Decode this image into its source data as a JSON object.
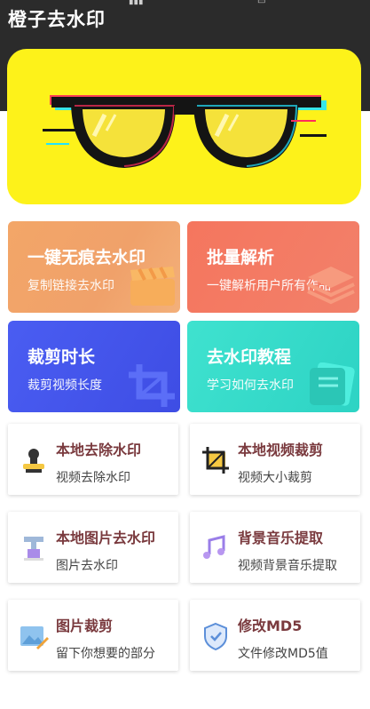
{
  "app": {
    "title": "橙子去水印"
  },
  "colors": {
    "header_bg": "#2b2b2b",
    "banner_bg": "#fdf21a",
    "card_orange": "#f3a668",
    "card_red": "#f5765e",
    "card_blue": "#4a5df2",
    "card_teal": "#3fe2cf",
    "tool_title": "#7a3a3e"
  },
  "banner": {
    "icon": "glitch-glasses-icon"
  },
  "feature_cards": [
    {
      "title": "一键无痕去水印",
      "subtitle": "复制链接去水印",
      "icon": "clapperboard-icon"
    },
    {
      "title": "批量解析",
      "subtitle": "一键解析用户所有作品",
      "icon": "layers-icon"
    },
    {
      "title": "裁剪时长",
      "subtitle": "裁剪视频长度",
      "icon": "crop-icon"
    },
    {
      "title": "去水印教程",
      "subtitle": "学习如何去水印",
      "icon": "book-icon"
    }
  ],
  "tools": [
    {
      "title": "本地去除水印",
      "subtitle": "视频去除水印",
      "icon": "stamp-icon"
    },
    {
      "title": "本地视频裁剪",
      "subtitle": "视频大小裁剪",
      "icon": "crop-frame-icon"
    },
    {
      "title": "本地图片去水印",
      "subtitle": "图片去水印",
      "icon": "brush-icon"
    },
    {
      "title": "背景音乐提取",
      "subtitle": "视频背景音乐提取",
      "icon": "music-note-icon"
    },
    {
      "title": "图片裁剪",
      "subtitle": "留下你想要的部分",
      "icon": "image-edit-icon"
    },
    {
      "title": "修改MD5",
      "subtitle": "文件修改MD5值",
      "icon": "shield-icon"
    }
  ]
}
